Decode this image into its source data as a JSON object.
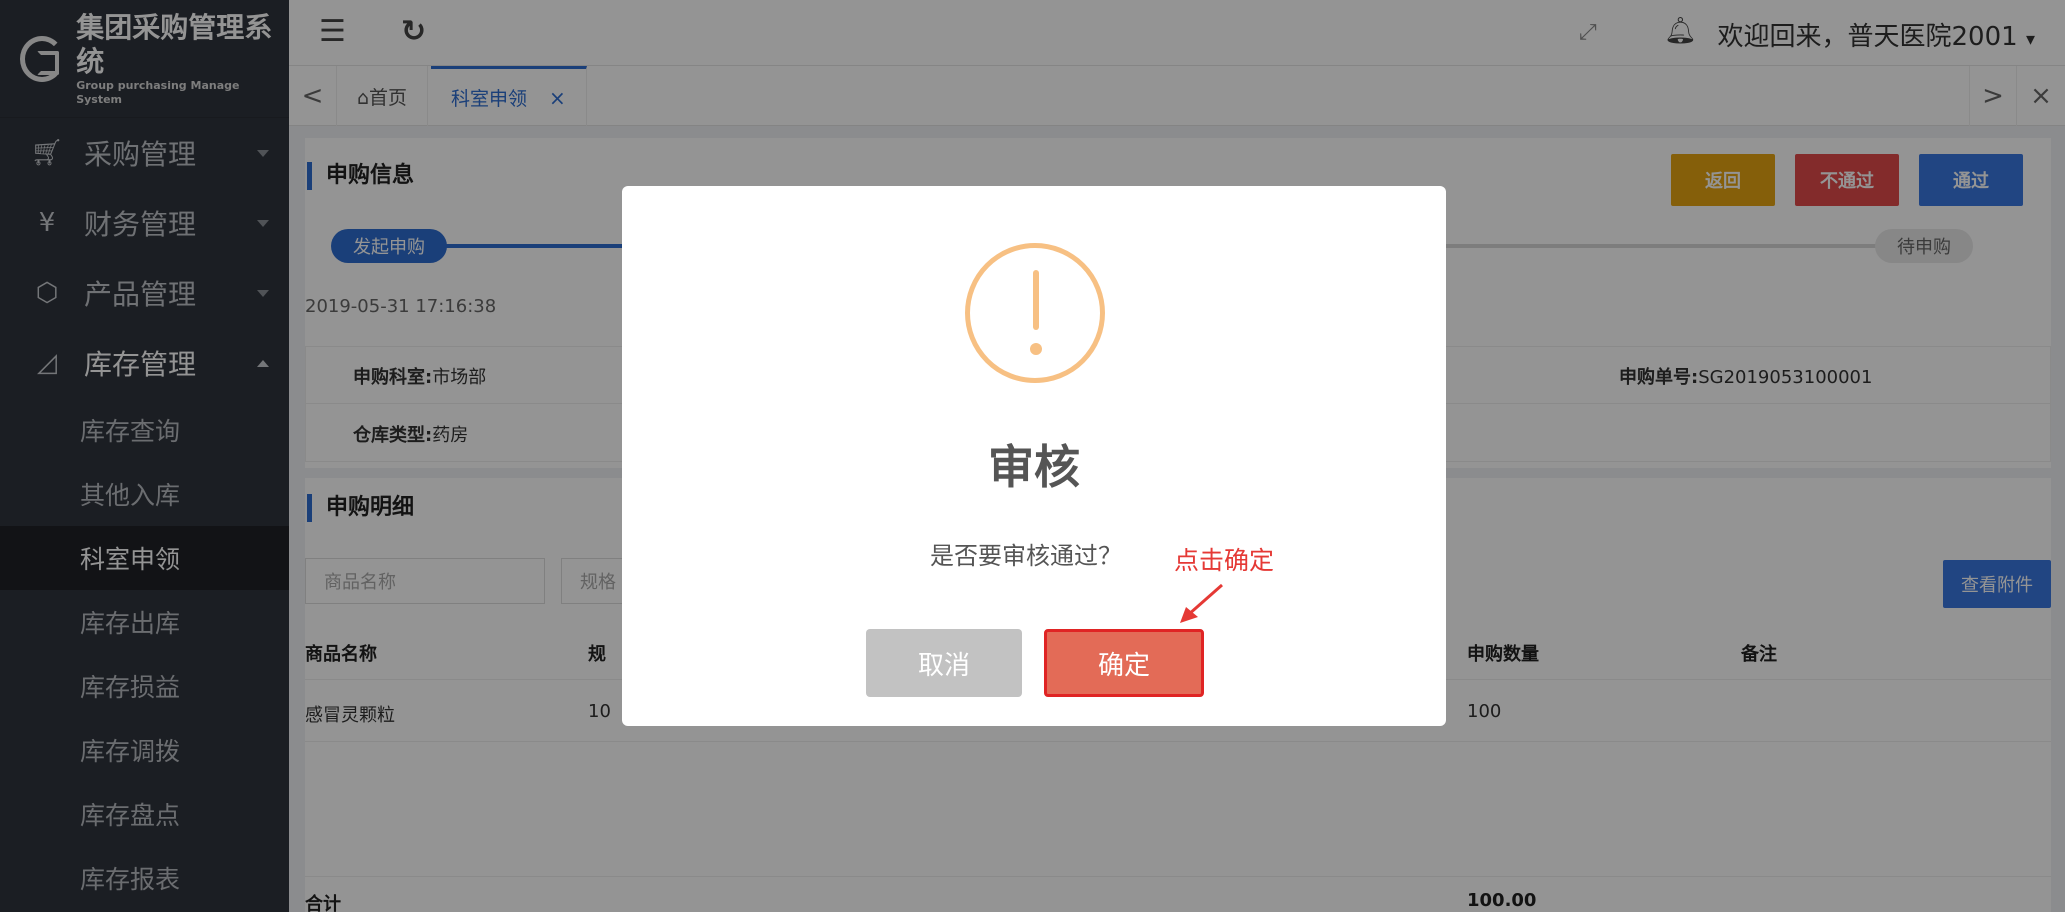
{
  "app": {
    "title": "集团采购管理系统",
    "subtitle": "Group purchasing Manage System"
  },
  "sidebar": {
    "menus": [
      {
        "label": "采购管理",
        "icon": "cart-icon"
      },
      {
        "label": "财务管理",
        "icon": "yen-icon"
      },
      {
        "label": "产品管理",
        "icon": "box-icon"
      },
      {
        "label": "库存管理",
        "icon": "chart-icon"
      }
    ],
    "submenu": [
      "库存查询",
      "其他入库",
      "科室申领",
      "库存出库",
      "库存损益",
      "库存调拨",
      "库存盘点",
      "库存报表"
    ],
    "active_sub": "科室申领"
  },
  "topbar": {
    "welcome": "欢迎回来，普天医院2001"
  },
  "tabs": {
    "home": "⌂首页",
    "active": "科室申领",
    "close": "×"
  },
  "purchase_info": {
    "section_title": "申购信息",
    "buttons": {
      "back": "返回",
      "reject": "不通过",
      "approve": "通过"
    },
    "step_start": "发起申购",
    "step_end": "待申购",
    "timestamp": "2019-05-31 17:16:38",
    "dept_label": "申购科室:",
    "dept_value": "市场部",
    "order_label": "申购单号:",
    "order_value": "SG2019053100001",
    "warehouse_label": "仓库类型:",
    "warehouse_value": "药房"
  },
  "purchase_detail": {
    "section_title": "申购明细",
    "search_name_placeholder": "商品名称",
    "search_spec_placeholder": "规格",
    "attachment_button": "查看附件",
    "columns": [
      "商品名称",
      "规",
      "申购数量",
      "备注"
    ],
    "rows": [
      {
        "name": "感冒灵颗粒",
        "spec": "10",
        "qty": "100",
        "note": ""
      }
    ],
    "total_label": "合计",
    "total_value": "100.00"
  },
  "modal": {
    "title": "审核",
    "message": "是否要审核通过？",
    "cancel": "取消",
    "confirm": "确定",
    "annotation": "点击确定"
  }
}
